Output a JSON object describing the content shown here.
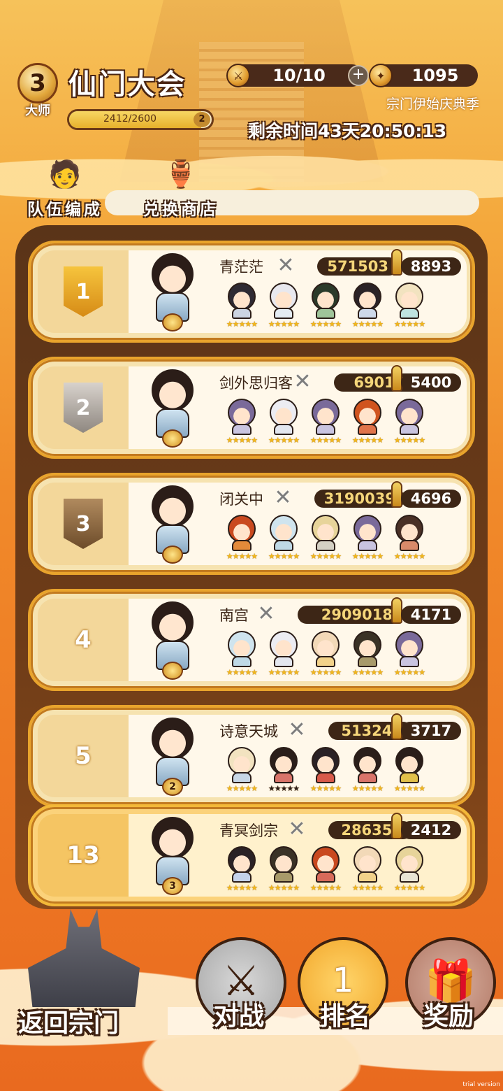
{
  "header": {
    "title": "仙门大会",
    "rank_level": "3",
    "rank_title": "大师",
    "exp_text": "2412/2600",
    "exp_fraction": 0.928,
    "exp_badge": "2",
    "stamina": "10/10",
    "currency": "1095",
    "season_name": "宗门伊始庆典季",
    "time_left": "剩余时间43天20:50:13"
  },
  "quick_menu": [
    {
      "label": "队伍编成",
      "icon": "team-member-icon"
    },
    {
      "label": "兑换商店",
      "icon": "token-shop-icon"
    }
  ],
  "ranking": [
    {
      "rank": "1",
      "name": "青茫茫",
      "power": "571503",
      "score": "8893",
      "flag": "gold",
      "heroes": [
        {
          "hair": "#2e2a33",
          "robe": "#cbd4e2",
          "stars": "★★★★★"
        },
        {
          "hair": "#e8e8ee",
          "robe": "#e4ecf3",
          "stars": "★★★★★"
        },
        {
          "hair": "#2b3a2a",
          "robe": "#9fc49a",
          "stars": "★★★★★"
        },
        {
          "hair": "#2a2226",
          "robe": "#cdd9ea",
          "stars": "★★★★★"
        },
        {
          "hair": "#f2e3c0",
          "robe": "#bfe3e0",
          "stars": "★★★★★"
        }
      ]
    },
    {
      "rank": "2",
      "name": "剑外思归客",
      "power": "690132",
      "score": "5400",
      "flag": "silver",
      "heroes": [
        {
          "hair": "#7a6a9a",
          "robe": "#c9c4e0",
          "stars": "★★★★★"
        },
        {
          "hair": "#ececf2",
          "robe": "#e3e6ee",
          "stars": "★★★★★"
        },
        {
          "hair": "#7a6a9a",
          "robe": "#c9c4e0",
          "stars": "★★★★★"
        },
        {
          "hair": "#d0541f",
          "robe": "#e0734a",
          "stars": "★★★★★"
        },
        {
          "hair": "#7a6a9a",
          "robe": "#c9c4e0",
          "stars": "★★★★★"
        }
      ]
    },
    {
      "rank": "3",
      "name": "闭关中",
      "power": "3190039",
      "score": "4696",
      "flag": "bronze",
      "heroes": [
        {
          "hair": "#c9491f",
          "robe": "#e38a3a",
          "stars": "★★★★★"
        },
        {
          "hair": "#cfe4ee",
          "robe": "#bfd9e6",
          "stars": "★★★★★"
        },
        {
          "hair": "#e7d49a",
          "robe": "#d4d0c4",
          "stars": "★★★★★"
        },
        {
          "hair": "#7a6a9a",
          "robe": "#c9c4e0",
          "stars": "★★★★★"
        },
        {
          "hair": "#4a3026",
          "robe": "#d88a6a",
          "stars": "★★★★★"
        }
      ]
    },
    {
      "rank": "4",
      "name": "南宫",
      "power": "2909018",
      "score": "4171",
      "flag": "none",
      "heroes": [
        {
          "hair": "#cfe4ee",
          "robe": "#bfd9e6",
          "stars": "★★★★★"
        },
        {
          "hair": "#ececf2",
          "robe": "#e3e6ee",
          "stars": "★★★★★"
        },
        {
          "hair": "#f2d9b8",
          "robe": "#f2d28a",
          "stars": "★★★★★"
        },
        {
          "hair": "#3a3226",
          "robe": "#a89a6a",
          "stars": "★★★★★"
        },
        {
          "hair": "#7a6a9a",
          "robe": "#c9c4e0",
          "stars": "★★★★★"
        }
      ]
    },
    {
      "rank": "5",
      "name": "诗意天城",
      "power": "513240",
      "score": "3717",
      "flag": "none",
      "heroes": [
        {
          "hair": "#f2e3c0",
          "robe": "#c8d7e6",
          "stars": "★★★★★"
        },
        {
          "hair": "#2a1e1a",
          "robe": "#d9746a",
          "stars": "★★★★★",
          "dark": true
        },
        {
          "hair": "#2a2226",
          "robe": "#d85a4a",
          "stars": "★★★★★"
        },
        {
          "hair": "#2a1e1a",
          "robe": "#d9746a",
          "stars": "★★★★★"
        },
        {
          "hair": "#2a1e1a",
          "robe": "#e2c04a",
          "stars": "★★★★★"
        }
      ]
    },
    {
      "rank": "13",
      "name": "青冥剑宗",
      "power": "286350",
      "score": "2412",
      "flag": "none",
      "mine": true,
      "heroes": [
        {
          "hair": "#2a2226",
          "robe": "#c4d2ea",
          "stars": "★★★★★"
        },
        {
          "hair": "#3a3226",
          "robe": "#a89a6a",
          "stars": "★★★★★"
        },
        {
          "hair": "#c9491f",
          "robe": "#d86a5a",
          "stars": "★★★★★"
        },
        {
          "hair": "#f2d9b8",
          "robe": "#f2d28a",
          "stars": "★★★★★"
        },
        {
          "hair": "#e7d49a",
          "robe": "#e8e4d4",
          "stars": "★★★★★"
        }
      ]
    }
  ],
  "bottom_nav": {
    "back": "返回宗门",
    "battle": "对战",
    "rank": "排名",
    "reward": "奖励",
    "rank_icon_number": "1"
  },
  "watermark": "trial version"
}
